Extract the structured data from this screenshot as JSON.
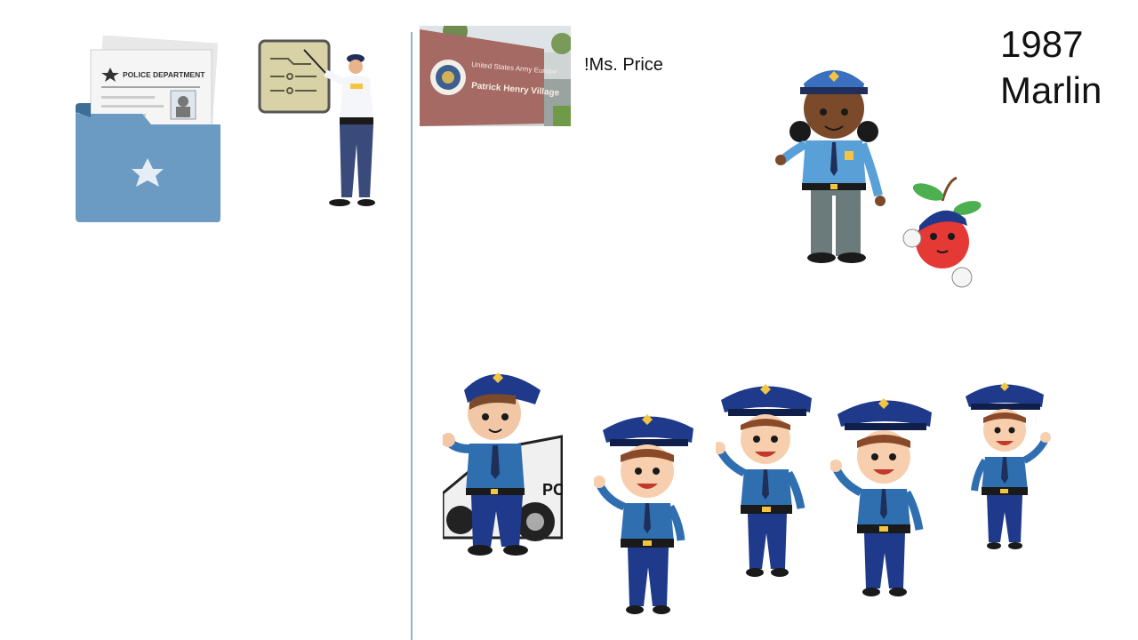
{
  "slide": {
    "title_line1": "1987",
    "title_line2": "Marlin",
    "caption": "!Ms. Price"
  },
  "folder": {
    "document_heading": "POLICE DEPARTMENT"
  },
  "photo": {
    "sign_line1": "United States Army Europe",
    "sign_line2": "Patrick Henry Village"
  },
  "car": {
    "door_text": "PO"
  },
  "colors": {
    "police_blue": "#1f3a8a",
    "shirt_blue": "#3b82c4",
    "folder_blue": "#6b9bc3",
    "divider": "#8fb4d8"
  },
  "icons": [
    "police-folder-icon",
    "officer-presenting-icon",
    "army-sign-photo",
    "policewoman-icon",
    "apple-officer-icon",
    "boy-officer-with-car-icon",
    "kid-officer-icon"
  ]
}
